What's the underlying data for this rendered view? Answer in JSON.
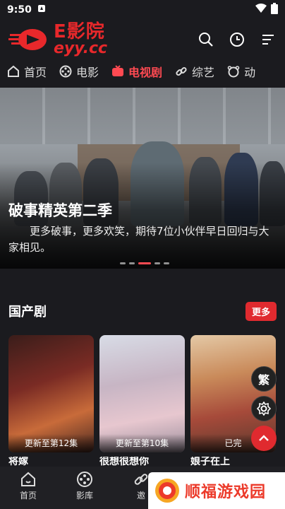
{
  "status": {
    "time": "9:50"
  },
  "app": {
    "logo_cn": "E影院",
    "logo_en": "eyy.cc"
  },
  "nav": [
    {
      "label": "首页",
      "icon": "home-icon"
    },
    {
      "label": "电影",
      "icon": "film-reel-icon"
    },
    {
      "label": "电视剧",
      "icon": "tv-icon",
      "active": true
    },
    {
      "label": "综艺",
      "icon": "link-icon"
    },
    {
      "label": "动",
      "icon": "bear-icon"
    }
  ],
  "banner": {
    "title": "破事精英第二季",
    "description": "更多破事，更多欢笑，期待7位小伙伴早日回归与大家相见。",
    "slide_count": 5,
    "active_slide": 2
  },
  "section": {
    "title": "国产剧",
    "more_label": "更多"
  },
  "cards": [
    {
      "episode": "更新至第12集",
      "name": "将嫁"
    },
    {
      "episode": "更新至第10集",
      "name": "很想很想你"
    },
    {
      "episode": "已完",
      "name": "娘子在上"
    }
  ],
  "fab": {
    "traditional": "繁"
  },
  "bottom_nav": [
    {
      "label": "首页",
      "icon": "home-icon"
    },
    {
      "label": "影库",
      "icon": "film-reel-icon"
    },
    {
      "label": "邀",
      "icon": "link-icon"
    }
  ],
  "watermark": {
    "text": "顺福游戏园"
  },
  "colors": {
    "accent": "#e8282b",
    "background": "#1b1b1f"
  }
}
